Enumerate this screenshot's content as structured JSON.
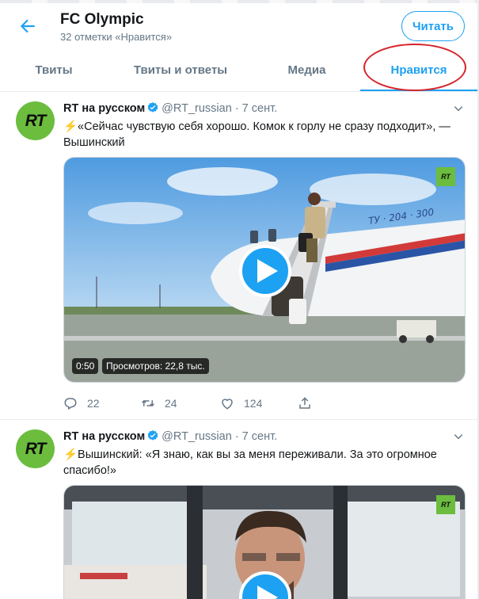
{
  "header": {
    "title": "FC Olympic",
    "subtitle": "32 отметки «Нравится»",
    "follow_label": "Читать"
  },
  "tabs": [
    {
      "label": "Твиты"
    },
    {
      "label": "Твиты и ответы"
    },
    {
      "label": "Медиа"
    },
    {
      "label": "Нравится"
    }
  ],
  "colors": {
    "accent": "#1da1f2",
    "rt_green": "#6cbd3e",
    "annotation_red": "#d6242b"
  },
  "tweets": [
    {
      "avatar_text": "RT",
      "name": "RT на русском",
      "handle": "@RT_russian",
      "date": "7 сент.",
      "text": "⚡«Сейчас чувствую себя хорошо. Комок к горлу не сразу подходит», — Вышинский",
      "media": {
        "badge": "RT",
        "plane_text": "ТУ · 204 · 300",
        "duration": "0:50",
        "views": "Просмотров: 22,8 тыс."
      },
      "stats": {
        "replies": "22",
        "retweets": "24",
        "likes": "124"
      }
    },
    {
      "avatar_text": "RT",
      "name": "RT на русском",
      "handle": "@RT_russian",
      "date": "7 сент.",
      "text": "⚡Вышинский: «Я знаю, как вы за меня переживали. За это огромное спасибо!»",
      "media": {
        "badge": "RT"
      }
    }
  ]
}
